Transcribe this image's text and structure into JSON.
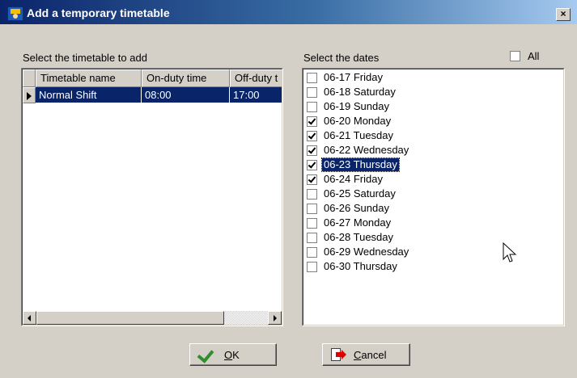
{
  "window": {
    "title": "Add a temporary timetable",
    "close_label": "×"
  },
  "timetable": {
    "section_label": "Select the timetable to add",
    "columns": [
      "Timetable name",
      "On-duty time",
      "Off-duty t"
    ],
    "rows": [
      {
        "name": "Normal Shift",
        "on_duty": "08:00",
        "off_duty": "17:00"
      }
    ]
  },
  "dates": {
    "section_label": "Select the dates",
    "all_label": "All",
    "items": [
      {
        "label": "06-17 Friday",
        "checked": false
      },
      {
        "label": "06-18 Saturday",
        "checked": false
      },
      {
        "label": "06-19 Sunday",
        "checked": false
      },
      {
        "label": "06-20 Monday",
        "checked": true
      },
      {
        "label": "06-21 Tuesday",
        "checked": true
      },
      {
        "label": "06-22 Wednesday",
        "checked": true
      },
      {
        "label": "06-23 Thursday",
        "checked": true,
        "selected": true
      },
      {
        "label": "06-24 Friday",
        "checked": true
      },
      {
        "label": "06-25 Saturday",
        "checked": false
      },
      {
        "label": "06-26 Sunday",
        "checked": false
      },
      {
        "label": "06-27 Monday",
        "checked": false
      },
      {
        "label": "06-28 Tuesday",
        "checked": false
      },
      {
        "label": "06-29 Wednesday",
        "checked": false
      },
      {
        "label": "06-30 Thursday",
        "checked": false
      }
    ]
  },
  "buttons": {
    "ok": {
      "label_first": "O",
      "label_rest": "K"
    },
    "cancel": {
      "label_first": "C",
      "label_rest": "ancel"
    }
  }
}
